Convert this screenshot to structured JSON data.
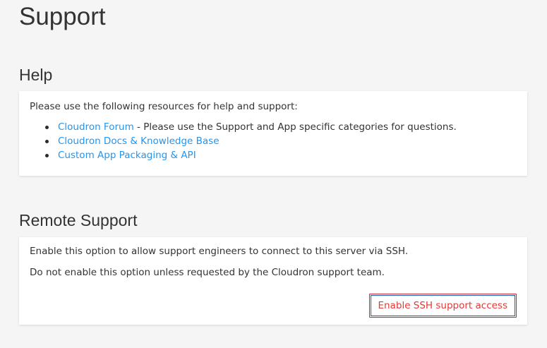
{
  "page": {
    "title": "Support"
  },
  "help": {
    "title": "Help",
    "intro": "Please use the following resources for help and support:",
    "links": [
      {
        "label": "Cloudron Forum",
        "suffix": " - Please use the Support and App specific categories for questions."
      },
      {
        "label": "Cloudron Docs & Knowledge Base",
        "suffix": ""
      },
      {
        "label": "Custom App Packaging & API",
        "suffix": ""
      }
    ]
  },
  "remote_support": {
    "title": "Remote Support",
    "description": "Enable this option to allow support engineers to connect to this server via SSH.",
    "warning": "Do not enable this option unless requested by the Cloudron support team.",
    "button_label": "Enable SSH support access"
  },
  "colors": {
    "background": "#f5f5f5",
    "link": "#2196f3",
    "danger": "#e53935",
    "focus_outline": "#1565c0"
  }
}
